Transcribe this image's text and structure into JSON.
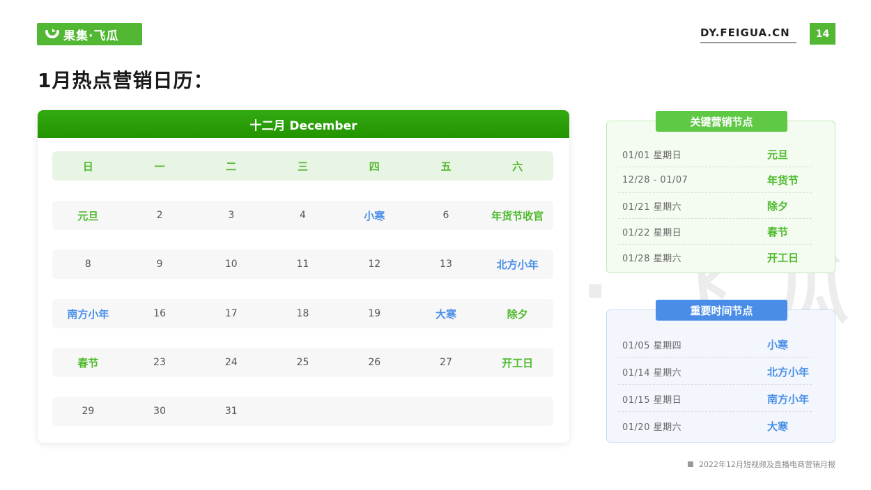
{
  "header": {
    "logo_text": "果集·飞瓜",
    "site_url": "DY.FEIGUA.CN",
    "page_number": "14"
  },
  "page_title": "1月热点营销日历：",
  "watermark_text": "果 集 · 飞 瓜",
  "calendar": {
    "title": "十二月 December",
    "weekdays": [
      "日",
      "一",
      "二",
      "三",
      "四",
      "五",
      "六"
    ],
    "rows": [
      [
        {
          "text": "元旦",
          "style": "green"
        },
        {
          "text": "2"
        },
        {
          "text": "3"
        },
        {
          "text": "4"
        },
        {
          "text": "小寒",
          "style": "blue"
        },
        {
          "text": "6"
        },
        {
          "text": "年货节收官",
          "style": "green"
        }
      ],
      [
        {
          "text": "8"
        },
        {
          "text": "9"
        },
        {
          "text": "10"
        },
        {
          "text": "11"
        },
        {
          "text": "12"
        },
        {
          "text": "13"
        },
        {
          "text": "北方小年",
          "style": "blue"
        }
      ],
      [
        {
          "text": "南方小年",
          "style": "blue"
        },
        {
          "text": "16"
        },
        {
          "text": "17"
        },
        {
          "text": "18"
        },
        {
          "text": "19"
        },
        {
          "text": "大寒",
          "style": "blue"
        },
        {
          "text": "除夕",
          "style": "green"
        }
      ],
      [
        {
          "text": "春节",
          "style": "green"
        },
        {
          "text": "23"
        },
        {
          "text": "24"
        },
        {
          "text": "25"
        },
        {
          "text": "26"
        },
        {
          "text": "27"
        },
        {
          "text": "开工日",
          "style": "green"
        }
      ],
      [
        {
          "text": "29"
        },
        {
          "text": "30"
        },
        {
          "text": "31"
        },
        {
          "text": ""
        },
        {
          "text": ""
        },
        {
          "text": ""
        },
        {
          "text": ""
        }
      ]
    ]
  },
  "key_marketing": {
    "tag": "关键营销节点",
    "accent": "#5fc845",
    "items": [
      {
        "date": "01/01  星期日",
        "name": "元旦"
      },
      {
        "date": "12/28 - 01/07",
        "name": "年货节"
      },
      {
        "date": "01/21  星期六",
        "name": "除夕"
      },
      {
        "date": "01/22  星期日",
        "name": "春节"
      },
      {
        "date": "01/28  星期六",
        "name": "开工日"
      }
    ]
  },
  "important_time": {
    "tag": "重要时间节点",
    "accent": "#4a8de8",
    "items": [
      {
        "date": "01/05  星期四",
        "name": "小寒"
      },
      {
        "date": "01/14  星期六",
        "name": "北方小年"
      },
      {
        "date": "01/15  星期日",
        "name": "南方小年"
      },
      {
        "date": "01/20  星期六",
        "name": "大寒"
      }
    ]
  },
  "footer": {
    "text": "2022年12月短视频及直播电商营销月报"
  }
}
